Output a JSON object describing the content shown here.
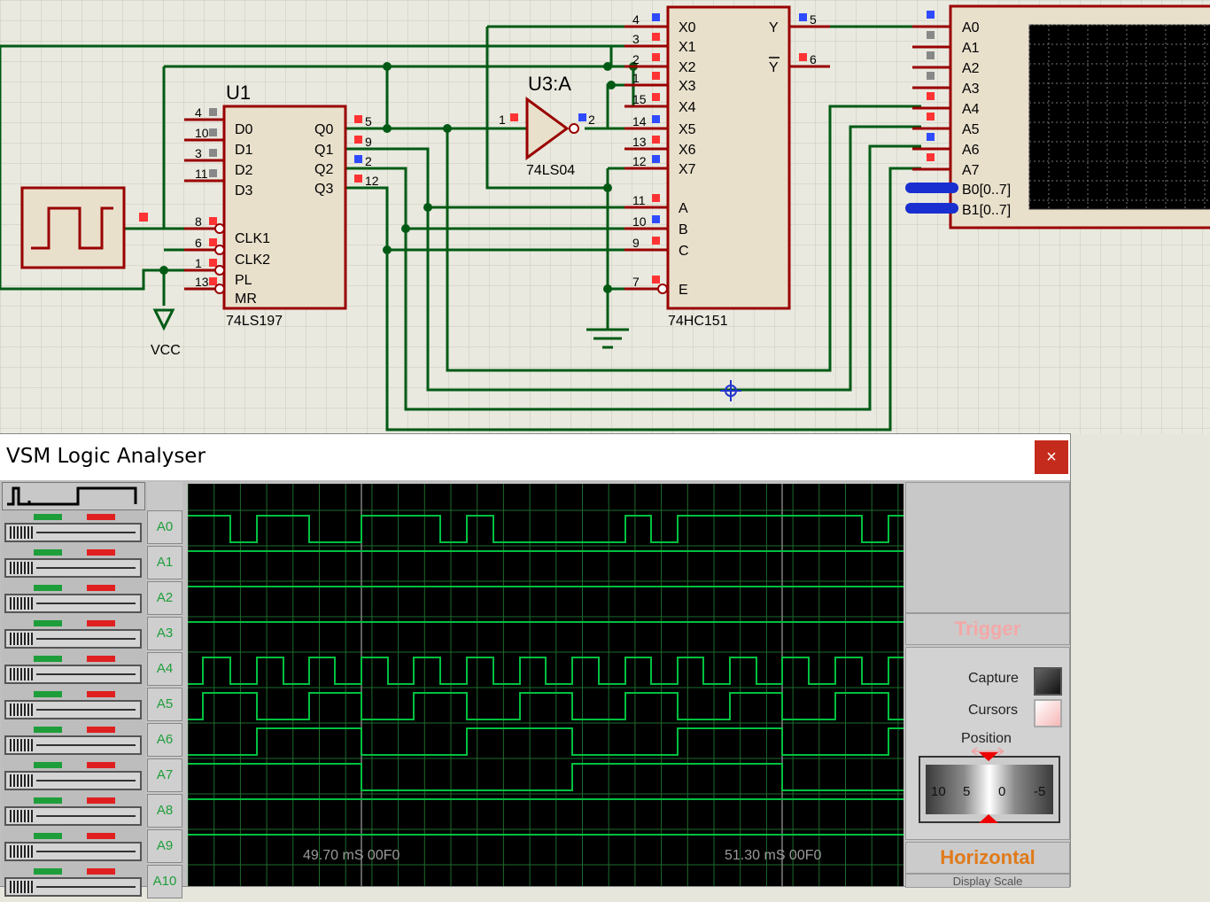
{
  "schematic": {
    "u1": {
      "ref": "U1",
      "part": "74LS197",
      "left_pins": [
        {
          "num": "4",
          "name": "D0"
        },
        {
          "num": "10",
          "name": "D1"
        },
        {
          "num": "3",
          "name": "D2"
        },
        {
          "num": "11",
          "name": "D3"
        },
        {
          "num": "8",
          "name": "CLK1"
        },
        {
          "num": "6",
          "name": "CLK2"
        },
        {
          "num": "1",
          "name": "PL"
        },
        {
          "num": "13",
          "name": "MR"
        }
      ],
      "right_pins": [
        {
          "num": "5",
          "name": "Q0"
        },
        {
          "num": "9",
          "name": "Q1"
        },
        {
          "num": "2",
          "name": "Q2"
        },
        {
          "num": "12",
          "name": "Q3"
        }
      ]
    },
    "u3": {
      "ref": "U3:A",
      "part": "74LS04",
      "pin_in": "1",
      "pin_out": "2"
    },
    "mux": {
      "part": "74HC151",
      "left_pins": [
        {
          "num": "4",
          "name": "X0"
        },
        {
          "num": "3",
          "name": "X1"
        },
        {
          "num": "2",
          "name": "X2"
        },
        {
          "num": "1",
          "name": "X3"
        },
        {
          "num": "15",
          "name": "X4"
        },
        {
          "num": "14",
          "name": "X5"
        },
        {
          "num": "13",
          "name": "X6"
        },
        {
          "num": "12",
          "name": "X7"
        },
        {
          "num": "11",
          "name": "A"
        },
        {
          "num": "10",
          "name": "B"
        },
        {
          "num": "9",
          "name": "C"
        },
        {
          "num": "7",
          "name": "E"
        }
      ],
      "right_pins": [
        {
          "num": "5",
          "name": "Y"
        },
        {
          "num": "6",
          "name": "Y"
        }
      ]
    },
    "vcc_label": "VCC",
    "analyser_pins": [
      "A0",
      "A1",
      "A2",
      "A3",
      "A4",
      "A5",
      "A6",
      "A7",
      "B0[0..7]",
      "B1[0..7]"
    ]
  },
  "analyser": {
    "title": "VSM Logic Analyser",
    "close_label": "×",
    "channels": [
      "A0",
      "A1",
      "A2",
      "A3",
      "A4",
      "A5",
      "A6",
      "A7",
      "A8",
      "A9",
      "A10"
    ],
    "cursor1_label": "49.70 mS 00F0",
    "cursor2_label": "51.30 mS 00F0",
    "trigger_label": "Trigger",
    "capture_label": "Capture",
    "cursors_label": "Cursors",
    "position_label": "Position",
    "knob_ticks": [
      "10",
      "5",
      "0",
      "-5"
    ],
    "horizontal_label": "Horizontal",
    "display_scale_label": "Display Scale",
    "colors": {
      "trace": "#00c040",
      "grid": "#1d6b2c",
      "cursor": "#808080",
      "wire": "#005a14",
      "part_outline": "#990000"
    }
  }
}
